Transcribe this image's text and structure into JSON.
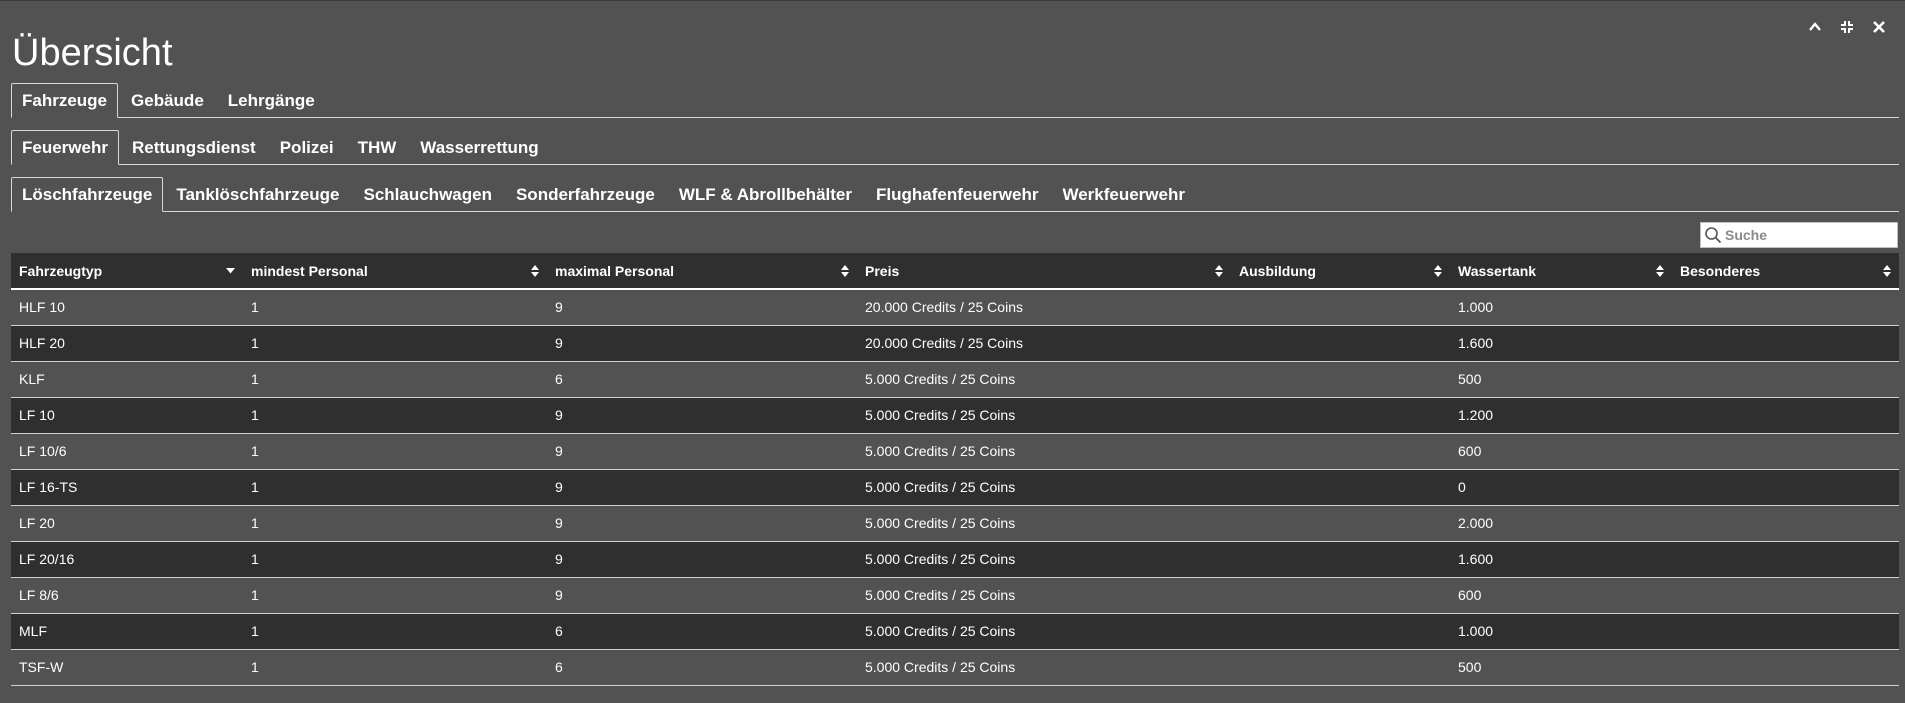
{
  "window": {
    "title": "Übersicht",
    "controls": [
      {
        "name": "collapse-icon"
      },
      {
        "name": "minimize-icon"
      },
      {
        "name": "close-icon"
      }
    ]
  },
  "tabs_level1": [
    {
      "label": "Fahrzeuge",
      "active": true
    },
    {
      "label": "Gebäude",
      "active": false
    },
    {
      "label": "Lehrgänge",
      "active": false
    }
  ],
  "tabs_level2": [
    {
      "label": "Feuerwehr",
      "active": true
    },
    {
      "label": "Rettungsdienst",
      "active": false
    },
    {
      "label": "Polizei",
      "active": false
    },
    {
      "label": "THW",
      "active": false
    },
    {
      "label": "Wasserrettung",
      "active": false
    }
  ],
  "tabs_level3": [
    {
      "label": "Löschfahrzeuge",
      "active": true
    },
    {
      "label": "Tanklöschfahrzeuge",
      "active": false
    },
    {
      "label": "Schlauchwagen",
      "active": false
    },
    {
      "label": "Sonderfahrzeuge",
      "active": false
    },
    {
      "label": "WLF & Abrollbehälter",
      "active": false
    },
    {
      "label": "Flughafenfeuerwehr",
      "active": false
    },
    {
      "label": "Werkfeuerwehr",
      "active": false
    }
  ],
  "search": {
    "placeholder": "Suche",
    "value": ""
  },
  "table": {
    "columns": [
      {
        "label": "Fahrzeugtyp",
        "sort": "desc"
      },
      {
        "label": "mindest Personal",
        "sort": "both"
      },
      {
        "label": "maximal Personal",
        "sort": "both"
      },
      {
        "label": "Preis",
        "sort": "both"
      },
      {
        "label": "Ausbildung",
        "sort": "both"
      },
      {
        "label": "Wassertank",
        "sort": "both"
      },
      {
        "label": "Besonderes",
        "sort": "both"
      }
    ],
    "rows": [
      [
        "HLF 10",
        "1",
        "9",
        "20.000 Credits / 25 Coins",
        "",
        "1.000",
        ""
      ],
      [
        "HLF 20",
        "1",
        "9",
        "20.000 Credits / 25 Coins",
        "",
        "1.600",
        ""
      ],
      [
        "KLF",
        "1",
        "6",
        "5.000 Credits / 25 Coins",
        "",
        "500",
        ""
      ],
      [
        "LF 10",
        "1",
        "9",
        "5.000 Credits / 25 Coins",
        "",
        "1.200",
        ""
      ],
      [
        "LF 10/6",
        "1",
        "9",
        "5.000 Credits / 25 Coins",
        "",
        "600",
        ""
      ],
      [
        "LF 16-TS",
        "1",
        "9",
        "5.000 Credits / 25 Coins",
        "",
        "0",
        ""
      ],
      [
        "LF 20",
        "1",
        "9",
        "5.000 Credits / 25 Coins",
        "",
        "2.000",
        ""
      ],
      [
        "LF 20/16",
        "1",
        "9",
        "5.000 Credits / 25 Coins",
        "",
        "1.600",
        ""
      ],
      [
        "LF 8/6",
        "1",
        "9",
        "5.000 Credits / 25 Coins",
        "",
        "600",
        ""
      ],
      [
        "MLF",
        "1",
        "6",
        "5.000 Credits / 25 Coins",
        "",
        "1.000",
        ""
      ],
      [
        "TSF-W",
        "1",
        "6",
        "5.000 Credits / 25 Coins",
        "",
        "500",
        ""
      ]
    ]
  },
  "colors": {
    "background": "#525252",
    "header_bg": "#2f2f2f",
    "row_dark": "#2f2f2f",
    "text": "#ffffff"
  }
}
